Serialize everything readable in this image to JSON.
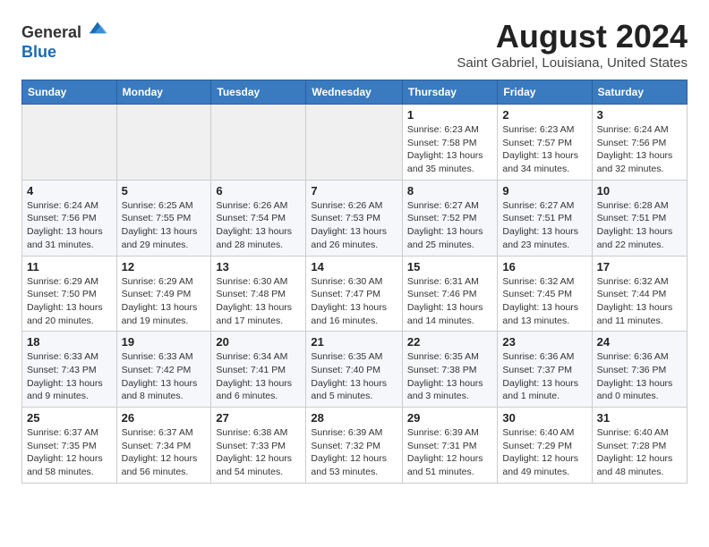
{
  "header": {
    "logo_line1": "General",
    "logo_line2": "Blue",
    "month_title": "August 2024",
    "subtitle": "Saint Gabriel, Louisiana, United States"
  },
  "days_of_week": [
    "Sunday",
    "Monday",
    "Tuesday",
    "Wednesday",
    "Thursday",
    "Friday",
    "Saturday"
  ],
  "weeks": [
    [
      {
        "day": "",
        "info": ""
      },
      {
        "day": "",
        "info": ""
      },
      {
        "day": "",
        "info": ""
      },
      {
        "day": "",
        "info": ""
      },
      {
        "day": "1",
        "info": "Sunrise: 6:23 AM\nSunset: 7:58 PM\nDaylight: 13 hours\nand 35 minutes."
      },
      {
        "day": "2",
        "info": "Sunrise: 6:23 AM\nSunset: 7:57 PM\nDaylight: 13 hours\nand 34 minutes."
      },
      {
        "day": "3",
        "info": "Sunrise: 6:24 AM\nSunset: 7:56 PM\nDaylight: 13 hours\nand 32 minutes."
      }
    ],
    [
      {
        "day": "4",
        "info": "Sunrise: 6:24 AM\nSunset: 7:56 PM\nDaylight: 13 hours\nand 31 minutes."
      },
      {
        "day": "5",
        "info": "Sunrise: 6:25 AM\nSunset: 7:55 PM\nDaylight: 13 hours\nand 29 minutes."
      },
      {
        "day": "6",
        "info": "Sunrise: 6:26 AM\nSunset: 7:54 PM\nDaylight: 13 hours\nand 28 minutes."
      },
      {
        "day": "7",
        "info": "Sunrise: 6:26 AM\nSunset: 7:53 PM\nDaylight: 13 hours\nand 26 minutes."
      },
      {
        "day": "8",
        "info": "Sunrise: 6:27 AM\nSunset: 7:52 PM\nDaylight: 13 hours\nand 25 minutes."
      },
      {
        "day": "9",
        "info": "Sunrise: 6:27 AM\nSunset: 7:51 PM\nDaylight: 13 hours\nand 23 minutes."
      },
      {
        "day": "10",
        "info": "Sunrise: 6:28 AM\nSunset: 7:51 PM\nDaylight: 13 hours\nand 22 minutes."
      }
    ],
    [
      {
        "day": "11",
        "info": "Sunrise: 6:29 AM\nSunset: 7:50 PM\nDaylight: 13 hours\nand 20 minutes."
      },
      {
        "day": "12",
        "info": "Sunrise: 6:29 AM\nSunset: 7:49 PM\nDaylight: 13 hours\nand 19 minutes."
      },
      {
        "day": "13",
        "info": "Sunrise: 6:30 AM\nSunset: 7:48 PM\nDaylight: 13 hours\nand 17 minutes."
      },
      {
        "day": "14",
        "info": "Sunrise: 6:30 AM\nSunset: 7:47 PM\nDaylight: 13 hours\nand 16 minutes."
      },
      {
        "day": "15",
        "info": "Sunrise: 6:31 AM\nSunset: 7:46 PM\nDaylight: 13 hours\nand 14 minutes."
      },
      {
        "day": "16",
        "info": "Sunrise: 6:32 AM\nSunset: 7:45 PM\nDaylight: 13 hours\nand 13 minutes."
      },
      {
        "day": "17",
        "info": "Sunrise: 6:32 AM\nSunset: 7:44 PM\nDaylight: 13 hours\nand 11 minutes."
      }
    ],
    [
      {
        "day": "18",
        "info": "Sunrise: 6:33 AM\nSunset: 7:43 PM\nDaylight: 13 hours\nand 9 minutes."
      },
      {
        "day": "19",
        "info": "Sunrise: 6:33 AM\nSunset: 7:42 PM\nDaylight: 13 hours\nand 8 minutes."
      },
      {
        "day": "20",
        "info": "Sunrise: 6:34 AM\nSunset: 7:41 PM\nDaylight: 13 hours\nand 6 minutes."
      },
      {
        "day": "21",
        "info": "Sunrise: 6:35 AM\nSunset: 7:40 PM\nDaylight: 13 hours\nand 5 minutes."
      },
      {
        "day": "22",
        "info": "Sunrise: 6:35 AM\nSunset: 7:38 PM\nDaylight: 13 hours\nand 3 minutes."
      },
      {
        "day": "23",
        "info": "Sunrise: 6:36 AM\nSunset: 7:37 PM\nDaylight: 13 hours\nand 1 minute."
      },
      {
        "day": "24",
        "info": "Sunrise: 6:36 AM\nSunset: 7:36 PM\nDaylight: 13 hours\nand 0 minutes."
      }
    ],
    [
      {
        "day": "25",
        "info": "Sunrise: 6:37 AM\nSunset: 7:35 PM\nDaylight: 12 hours\nand 58 minutes."
      },
      {
        "day": "26",
        "info": "Sunrise: 6:37 AM\nSunset: 7:34 PM\nDaylight: 12 hours\nand 56 minutes."
      },
      {
        "day": "27",
        "info": "Sunrise: 6:38 AM\nSunset: 7:33 PM\nDaylight: 12 hours\nand 54 minutes."
      },
      {
        "day": "28",
        "info": "Sunrise: 6:39 AM\nSunset: 7:32 PM\nDaylight: 12 hours\nand 53 minutes."
      },
      {
        "day": "29",
        "info": "Sunrise: 6:39 AM\nSunset: 7:31 PM\nDaylight: 12 hours\nand 51 minutes."
      },
      {
        "day": "30",
        "info": "Sunrise: 6:40 AM\nSunset: 7:29 PM\nDaylight: 12 hours\nand 49 minutes."
      },
      {
        "day": "31",
        "info": "Sunrise: 6:40 AM\nSunset: 7:28 PM\nDaylight: 12 hours\nand 48 minutes."
      }
    ]
  ]
}
